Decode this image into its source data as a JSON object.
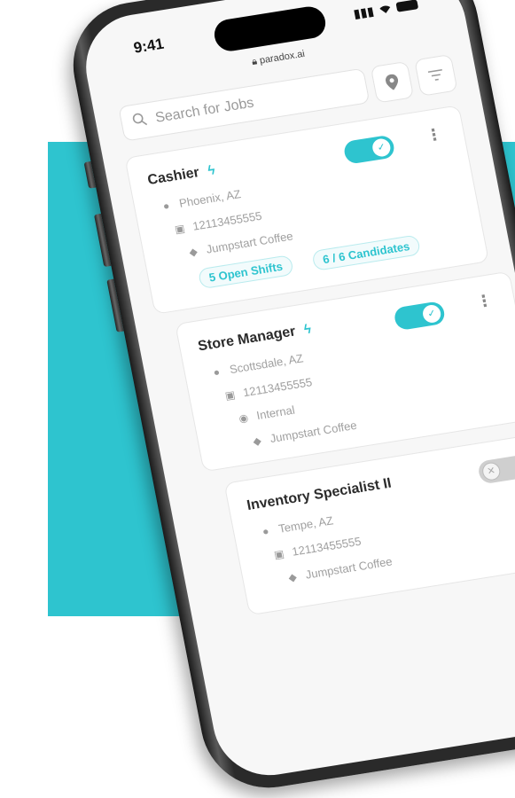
{
  "status_bar": {
    "time": "9:41",
    "signal": "▐▌",
    "wifi": "▿"
  },
  "browser": {
    "url": "paradox.ai",
    "lock_icon": "lock-icon"
  },
  "search": {
    "placeholder": "Search for Jobs",
    "search_icon": "search-icon",
    "location_icon": "location-pin-icon",
    "filter_icon": "filter-icon"
  },
  "colors": {
    "accent": "#2ec4cf",
    "text": "#2b2b2b",
    "muted": "#a0a0a0"
  },
  "jobs": [
    {
      "title": "Cashier",
      "bolt": "ϟ",
      "location": "Phoenix, AZ",
      "id": "12113455555",
      "company": "Jumpstart Coffee",
      "active": true,
      "open_shifts": "5 Open Shifts",
      "candidates": "6 / 6 Candidates"
    },
    {
      "title": "Store Manager",
      "bolt": "ϟ",
      "location": "Scottsdale, AZ",
      "id": "12113455555",
      "visibility": "Internal",
      "company": "Jumpstart Coffee",
      "active": true
    },
    {
      "title": "Inventory Specialist II",
      "location": "Tempe, AZ",
      "id": "12113455555",
      "company": "Jumpstart Coffee",
      "active": false
    }
  ]
}
